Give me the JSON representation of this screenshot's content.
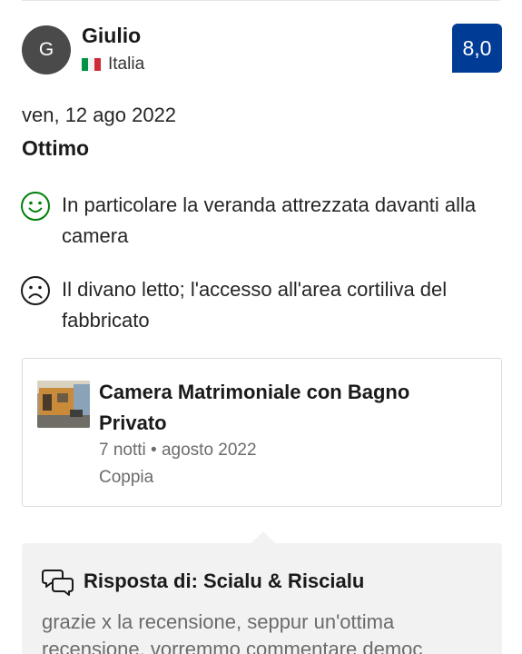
{
  "reviewer": {
    "avatar_initial": "G",
    "name": "Giulio",
    "country": "Italia",
    "flag_colors": [
      "#009246",
      "#ffffff",
      "#ce2b37"
    ]
  },
  "score": "8,0",
  "review": {
    "date": "ven, 12 ago 2022",
    "title": "Ottimo",
    "positive": "In particolare la veranda attrezzata davanti alla camera",
    "negative": "Il divano letto; l'accesso all'area cortiliva del fabbricato"
  },
  "room": {
    "name": "Camera Matrimoniale con Bagno Privato",
    "stay": "7 notti • agosto 2022",
    "traveler_type": "Coppia"
  },
  "reply": {
    "title": "Risposta di: Scialu & Riscialu",
    "text": "grazie x la recensione, seppur un'ottima recensione, vorremmo commentare democ"
  },
  "colors": {
    "score_bg": "#003b95",
    "positive_icon": "#008009",
    "negative_icon": "#1a1a1a"
  }
}
